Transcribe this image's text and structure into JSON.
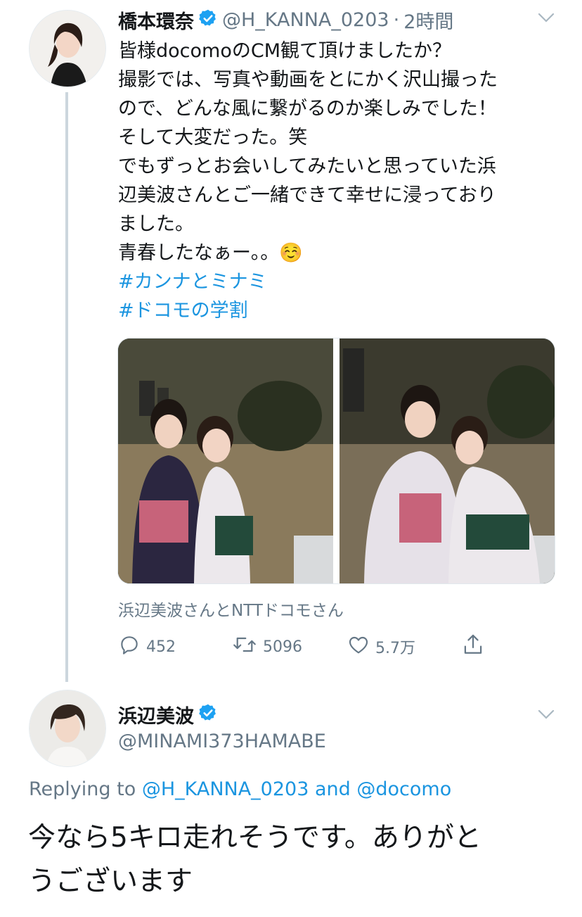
{
  "tweet1": {
    "display_name": "橋本環奈",
    "handle": "@H_KANNA_0203",
    "separator": "·",
    "time": "2時間",
    "lines": [
      "皆様docomoのCM観て頂けましたか？",
      "撮影では、写真や動画をとにかく沢山撮った",
      "ので、どんな風に繋がるのか楽しみでした！",
      "そして大変だった。笑",
      "でもずっとお会いしてみたいと思っていた浜",
      "辺美波さんとご一緒できて幸せに浸っており",
      "ました。",
      "青春したなぁー。。☺️"
    ],
    "hashtags": [
      "#カンナとミナミ",
      "#ドコモの学割"
    ],
    "media_caption": "浜辺美波さんとNTTドコモさん",
    "replies": "452",
    "retweets": "5096",
    "likes": "5.7万"
  },
  "tweet2": {
    "display_name": "浜辺美波",
    "handle": "@MINAMI373HAMABE",
    "replying_prefix": "Replying to",
    "replying_user1": "@H_KANNA_0203",
    "replying_and": "and",
    "replying_user2": "@docomo",
    "lines": [
      "今なら5キロ走れそうです。ありがと",
      "うございます"
    ]
  },
  "colors": {
    "link": "#1b95e0",
    "secondary": "#657786",
    "verified": "#1da1f2"
  },
  "icons": [
    "verified-badge-icon",
    "chevron-down-icon",
    "reply-icon",
    "retweet-icon",
    "like-icon",
    "share-icon"
  ]
}
